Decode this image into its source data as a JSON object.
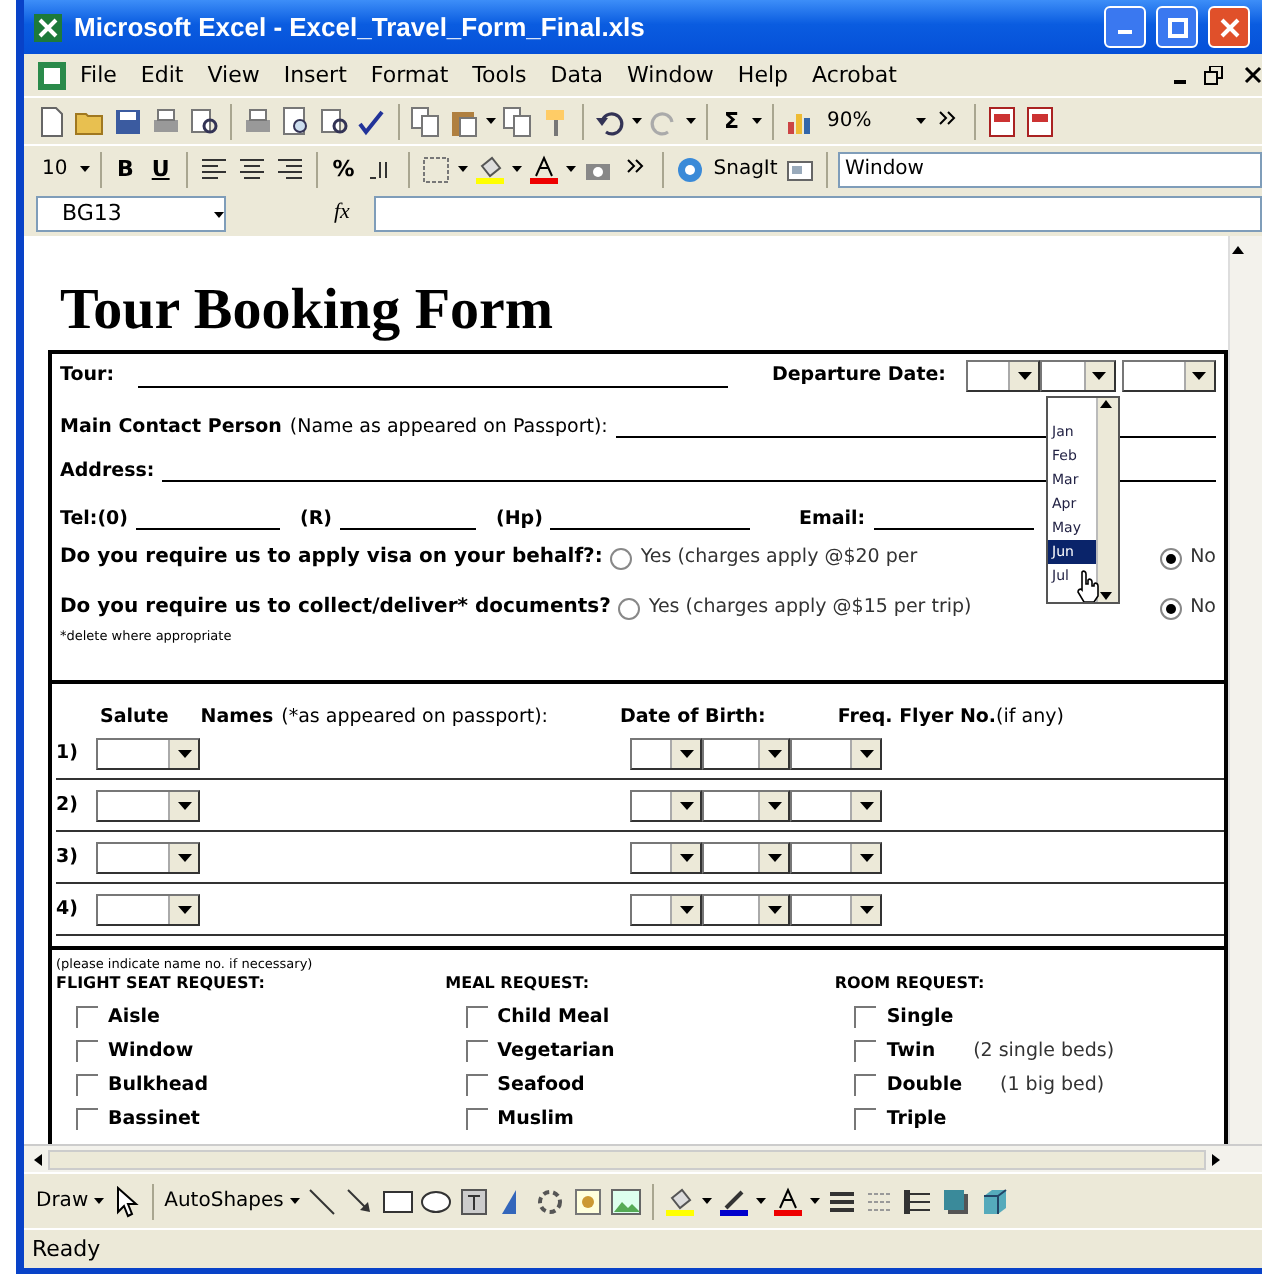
{
  "window": {
    "title": "Microsoft Excel - Excel_Travel_Form_Final.xls"
  },
  "menu": [
    "File",
    "Edit",
    "View",
    "Insert",
    "Format",
    "Tools",
    "Data",
    "Window",
    "Help",
    "Acrobat"
  ],
  "standard_toolbar": {
    "sum": "Σ",
    "zoom": "90%"
  },
  "formatting_toolbar": {
    "font_size": "10",
    "bold": "B",
    "underline": "U",
    "percent": "%",
    "snagit": "SnagIt",
    "window_field": "Window"
  },
  "formula_bar": {
    "name_box": "BG13",
    "function_label": "fx"
  },
  "form": {
    "title": "Tour Booking Form",
    "tour_label": "Tour:",
    "departure_label": "Departure Date:",
    "contact_label": "Main Contact Person",
    "contact_note": "(Name as appeared on Passport):",
    "address_label": "Address:",
    "phone_labels": [
      "Tel:(0)",
      "(R)",
      "(Hp)",
      "Email:"
    ],
    "questions": [
      {
        "text": "Do you require us to apply visa on your behalf?:",
        "options": [
          {
            "label": "Yes (charges apply @$20 per",
            "selected": false
          },
          {
            "label": "No",
            "selected": true
          }
        ]
      },
      {
        "text": "Do you require us to collect/deliver* documents?",
        "options": [
          {
            "label": "Yes (charges apply @$15 per trip)",
            "selected": false
          },
          {
            "label": "No",
            "selected": true
          }
        ]
      }
    ],
    "footnote": "*delete where appropriate",
    "month_list": [
      {
        "label": "Jan",
        "selected": false
      },
      {
        "label": "Feb",
        "selected": false
      },
      {
        "label": "Mar",
        "selected": false
      },
      {
        "label": "Apr",
        "selected": false
      },
      {
        "label": "May",
        "selected": false
      },
      {
        "label": "Jun",
        "selected": true
      },
      {
        "label": "Jul",
        "selected": false
      }
    ],
    "passenger_header": {
      "salute": "Salute",
      "names": "Names",
      "names_note": "(*as appeared on passport):",
      "dob": "Date of Birth:",
      "flyer": "Freq. Flyer No.",
      "flyer_note": "(if any)"
    },
    "passengers": [
      "1)",
      "2)",
      "3)",
      "4)"
    ],
    "requests_note": "(please indicate name no. if necessary)",
    "requests": [
      {
        "title": "FLIGHT SEAT REQUEST:",
        "options": [
          {
            "label": "Aisle",
            "checked": false
          },
          {
            "label": "Window",
            "checked": false
          },
          {
            "label": "Bulkhead",
            "checked": false
          },
          {
            "label": "Bassinet",
            "checked": false
          }
        ]
      },
      {
        "title": "MEAL REQUEST:",
        "options": [
          {
            "label": "Child Meal",
            "checked": false
          },
          {
            "label": "Vegetarian",
            "checked": false
          },
          {
            "label": "Seafood",
            "checked": false
          },
          {
            "label": "Muslim",
            "checked": false
          }
        ]
      },
      {
        "title": "ROOM REQUEST:",
        "options": [
          {
            "label": "Single",
            "checked": false
          },
          {
            "label": "Twin",
            "note": "(2 single beds)",
            "checked": false
          },
          {
            "label": "Double",
            "note": "(1 big bed)",
            "checked": false
          },
          {
            "label": "Triple",
            "checked": false
          }
        ]
      }
    ]
  },
  "draw_toolbar": {
    "draw": "Draw",
    "autoshapes": "AutoShapes"
  },
  "status_bar": "Ready"
}
